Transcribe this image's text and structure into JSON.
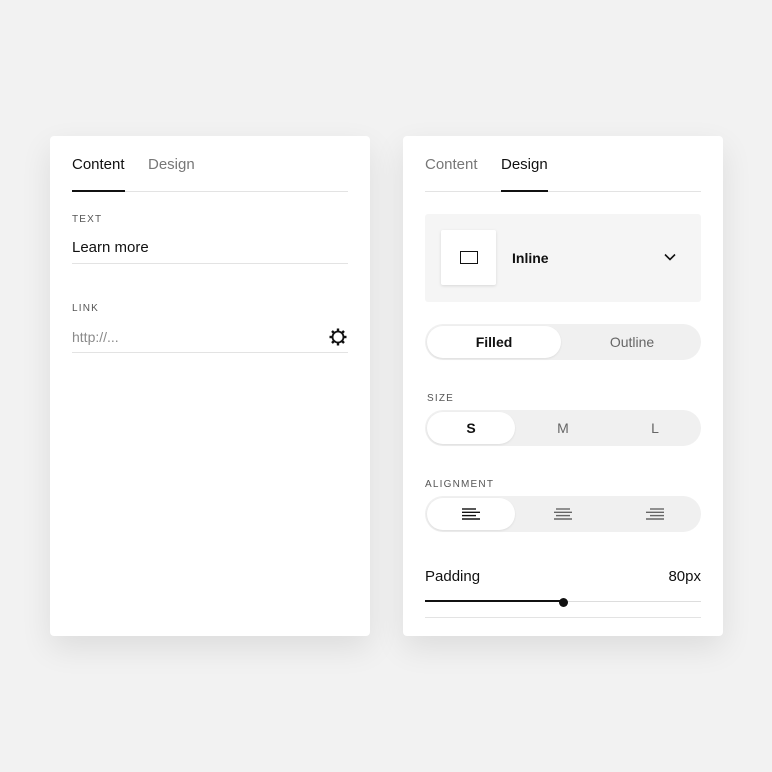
{
  "left_panel": {
    "tabs": [
      {
        "label": "Content"
      },
      {
        "label": "Design"
      }
    ],
    "text_label": "TEXT",
    "text_value": "Learn more",
    "link_label": "LINK",
    "link_placeholder": "http://..."
  },
  "right_panel": {
    "tabs": [
      {
        "label": "Content"
      },
      {
        "label": "Design"
      }
    ],
    "style_select": {
      "value": "Inline",
      "icon": "inline-rect-icon"
    },
    "fill_toggle": {
      "options": [
        "Filled",
        "Outline"
      ],
      "selected": "Filled"
    },
    "size": {
      "label": "SIZE",
      "options": [
        "S",
        "M",
        "L"
      ],
      "selected": "S"
    },
    "alignment": {
      "label": "ALIGNMENT",
      "options": [
        "left",
        "center",
        "right"
      ],
      "selected": "left"
    },
    "padding": {
      "label": "Padding",
      "value": "80px",
      "fraction": 0.5
    }
  },
  "colors": {
    "accent": "#111111",
    "background": "#f2f2f2",
    "panel": "#ffffff"
  }
}
